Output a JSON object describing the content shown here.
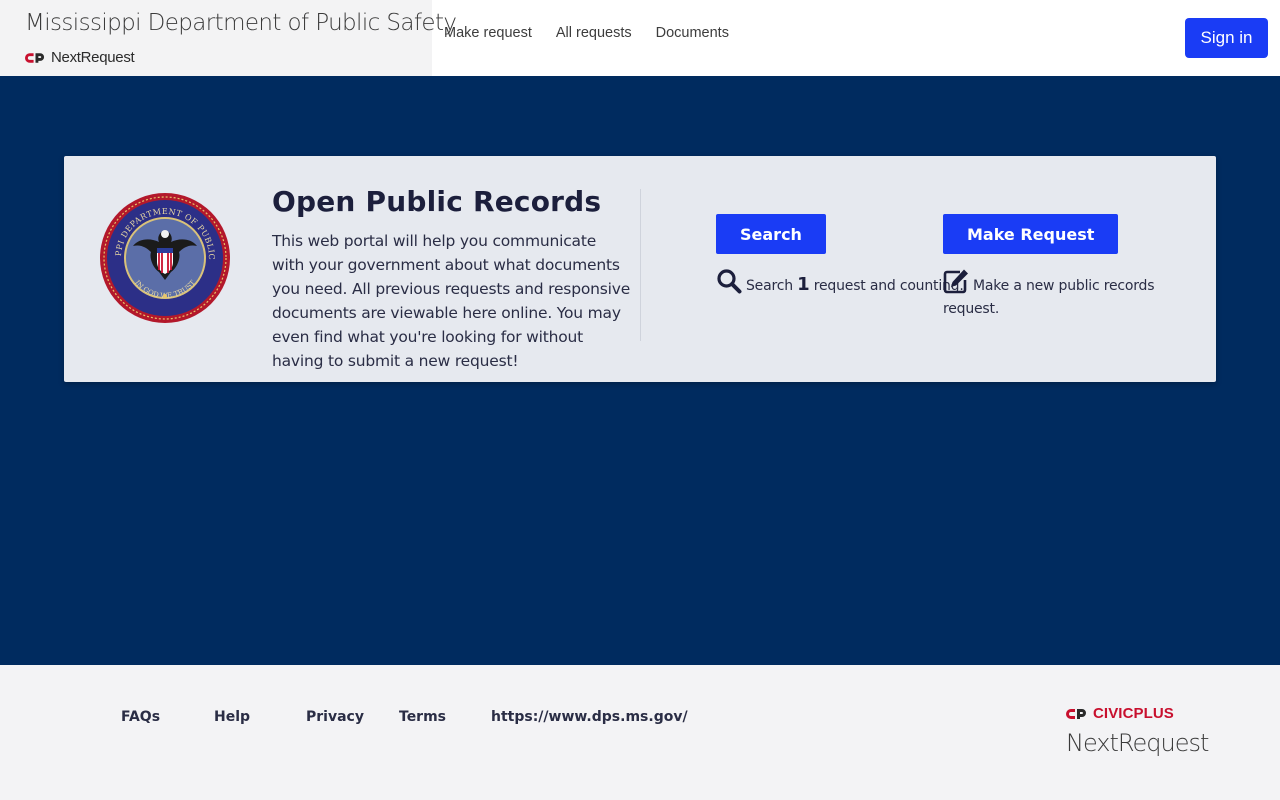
{
  "header": {
    "agency_title": "Mississippi Department of Public Safety",
    "logo_text": "NextRequest",
    "nav": [
      "Make request",
      "All requests",
      "Documents"
    ],
    "signin_label": "Sign in"
  },
  "hero": {
    "seal_top_text": "MISSISSIPPI DEPARTMENT OF PUBLIC SAFETY",
    "seal_bottom_text": "IN GOD WE TRUST",
    "title": "Open Public Records",
    "body": "This web portal will help you communicate with your government about what documents you need. All previous requests and responsive documents are viewable here online. You may even find what you're looking for without having to submit a new request!",
    "search": {
      "button_label": "Search",
      "desc_prefix": "Search",
      "count": "1",
      "desc_suffix": "request and counting.",
      "icon": "search-icon"
    },
    "make_request": {
      "button_label": "Make Request",
      "desc": "Make a new public records request.",
      "icon": "edit-icon"
    }
  },
  "footer": {
    "links": [
      "FAQs",
      "Help",
      "Privacy",
      "Terms",
      "https://www.dps.ms.gov/"
    ],
    "civicplus_label": "CIVICPLUS",
    "nextrequest_label": "NextRequest"
  },
  "colors": {
    "page_background": "#002b5f",
    "header_background": "#ffffff",
    "brand_box_background": "#f3f3f4",
    "card_background": "#e6e9ef",
    "button_primary": "#1a3cf5",
    "footer_background": "#f3f3f5",
    "civicplus_red": "#c8102e"
  }
}
